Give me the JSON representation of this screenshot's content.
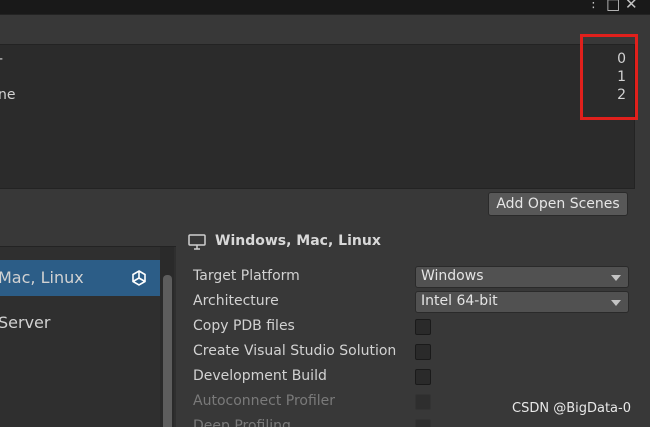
{
  "scene_list": {
    "items": [
      {
        "name": "-",
        "index": "0"
      },
      {
        "name": "",
        "index": "1"
      },
      {
        "name": "ne",
        "index": "2"
      }
    ]
  },
  "buttons": {
    "add_open_scenes": "Add Open Scenes"
  },
  "platforms": {
    "items": [
      {
        "label": "Mac, Linux",
        "selected": true,
        "icon": "unity-icon"
      },
      {
        "label": "Server",
        "selected": false
      }
    ]
  },
  "settings": {
    "title": "Windows, Mac, Linux",
    "title_icon": "monitor-icon",
    "target_platform": {
      "label": "Target Platform",
      "value": "Windows"
    },
    "architecture": {
      "label": "Architecture",
      "value": "Intel 64-bit"
    },
    "copy_pdb": {
      "label": "Copy PDB files",
      "checked": false
    },
    "create_vs_solution": {
      "label": "Create Visual Studio Solution",
      "checked": false
    },
    "development_build": {
      "label": "Development Build",
      "checked": false
    },
    "autoconnect_profiler": {
      "label": "Autoconnect Profiler",
      "checked": false,
      "disabled": true
    },
    "deep_profiling": {
      "label": "Deep Profiling",
      "checked": false,
      "disabled": true
    }
  },
  "watermark": "CSDN @BigData-0",
  "colors": {
    "highlight_box": "#e0201c",
    "selected_item": "#2c5d87"
  }
}
